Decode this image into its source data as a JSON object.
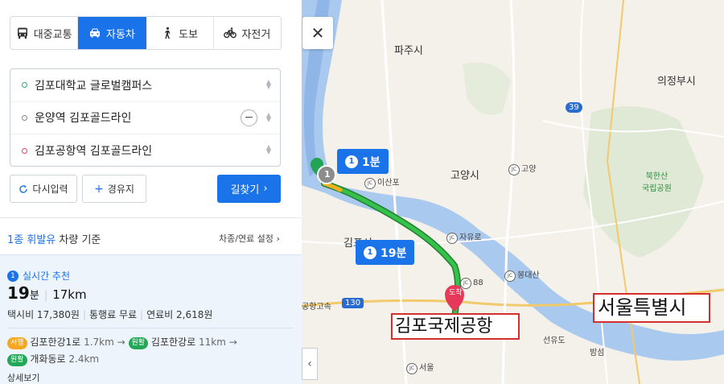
{
  "modes": [
    {
      "label": "대중교통",
      "icon": "bus-icon",
      "active": false
    },
    {
      "label": "자동차",
      "icon": "car-icon",
      "active": true
    },
    {
      "label": "도보",
      "icon": "walk-icon",
      "active": false
    },
    {
      "label": "자전거",
      "icon": "bicycle-icon",
      "active": false
    }
  ],
  "route": {
    "start": "김포대학교 글로벌캠퍼스",
    "via": "운양역 김포골드라인",
    "end": "김포공항역 김포골드라인",
    "minus_symbol": "−"
  },
  "buttons": {
    "reset": "다시입력",
    "add_via": "경유지",
    "find": "길찾기"
  },
  "fuel": {
    "type": "1종 휘발유",
    "suffix": "차량 기준",
    "setting": "차종/연료 설정"
  },
  "result": {
    "rank": "1",
    "rank_label": "실시간 추천",
    "minutes": "19",
    "min_unit": "분",
    "distance": "17km",
    "taxi": "택시비 17,380원",
    "toll": "통행료 무료",
    "fuel_cost": "연료비 2,618원",
    "segments": [
      {
        "tag": "서행",
        "road": "김포한강1로",
        "km": "1.7km"
      },
      {
        "tag": "원활",
        "road": "김포한강로",
        "km": "11km"
      },
      {
        "tag": "원활",
        "road": "개화동로",
        "km": "2.4km"
      }
    ],
    "detail": "상세보기"
  },
  "map": {
    "labels": {
      "paju": "파주시",
      "uijeongbu": "의정부시",
      "goyang": "고양시",
      "gimpo": "김포시",
      "bukhansan": "북한산\n국립공원",
      "ilsan": "이산포",
      "goyang_jc": "고양",
      "jayuro": "자유로",
      "bongdaesan": "봉대산",
      "seoul_small": "서울",
      "seonyu": "선유도",
      "bamseom": "밤섬",
      "gimpo_airport_small": "공항고속",
      "road_num_39": "39",
      "road_num_88": "88",
      "road_num_130": "130",
      "arrival": "도착"
    },
    "bubble_short": {
      "num": "1",
      "time": "1분"
    },
    "bubble_main": {
      "num": "1",
      "time": "19분"
    },
    "via_marker": "1",
    "annot_airport": "김포국제공항",
    "annot_seoul": "서울특별시",
    "close_symbol": "✕",
    "collapse_symbol": "‹"
  }
}
